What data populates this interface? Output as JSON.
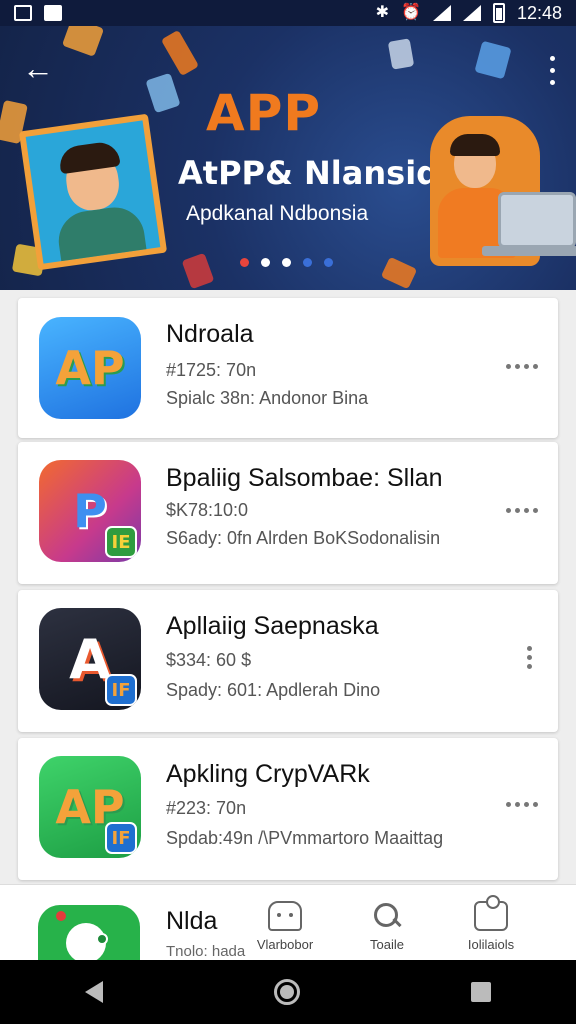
{
  "status_bar": {
    "time": "12:48",
    "icons": [
      "image-icon",
      "photo-icon",
      "bluetooth-icon",
      "alarm-icon",
      "wifi-icon",
      "signal-icon",
      "battery-icon"
    ]
  },
  "banner": {
    "title": "APP",
    "subtitle": "AtPP& Nlansid",
    "tagline": "Apdkanal Ndbonsia",
    "carousel_dots": 5,
    "active_dot": 1
  },
  "apps": [
    {
      "title": "Ndroala",
      "price": "#1725: 70n",
      "desc": "Spialc 38n: Andonor Bina",
      "icon": "ap-app-icon",
      "icon_bg": "#2f8ff0",
      "menu": "horizontal"
    },
    {
      "title": "Bpaliig Salsombae: Sllan",
      "price": "$K78:10:0",
      "desc": "S6ady: 0fn  Alrden BoKSodonalisin",
      "icon": "p-app-icon",
      "icon_bg": "#e9592f",
      "badge": "IE",
      "menu": "horizontal"
    },
    {
      "title": "Apllaiig Saepnaska",
      "price": "$334: 60 $",
      "desc": "Spady: 601: Apdlerah Dino",
      "icon": "a-app-icon",
      "icon_bg": "#1c1f2a",
      "badge": "IF",
      "menu": "vertical"
    },
    {
      "title": "Apkling CrypVARk",
      "price": "#223: 70n",
      "desc": "Spdab:49n  /\\PVmmartoro Maaittag",
      "icon": "ap-green-app-icon",
      "icon_bg": "#23b04b",
      "badge": "IF",
      "menu": "horizontal"
    }
  ],
  "bottom_peek": {
    "title": "Nlda",
    "subtitle": "Tnolo: hada"
  },
  "bottom_nav": [
    {
      "label": "Vlarbobor",
      "icon": "robot-icon"
    },
    {
      "label": "Toaile",
      "icon": "search-icon"
    },
    {
      "label": "Iolilaiols",
      "icon": "puzzle-icon"
    }
  ],
  "colors": {
    "banner_bg": "#1b3165",
    "accent_orange": "#f07a1e",
    "dot_red": "#e8453c",
    "dot_white": "#ffffff",
    "dot_blue": "#3a6fd8"
  }
}
